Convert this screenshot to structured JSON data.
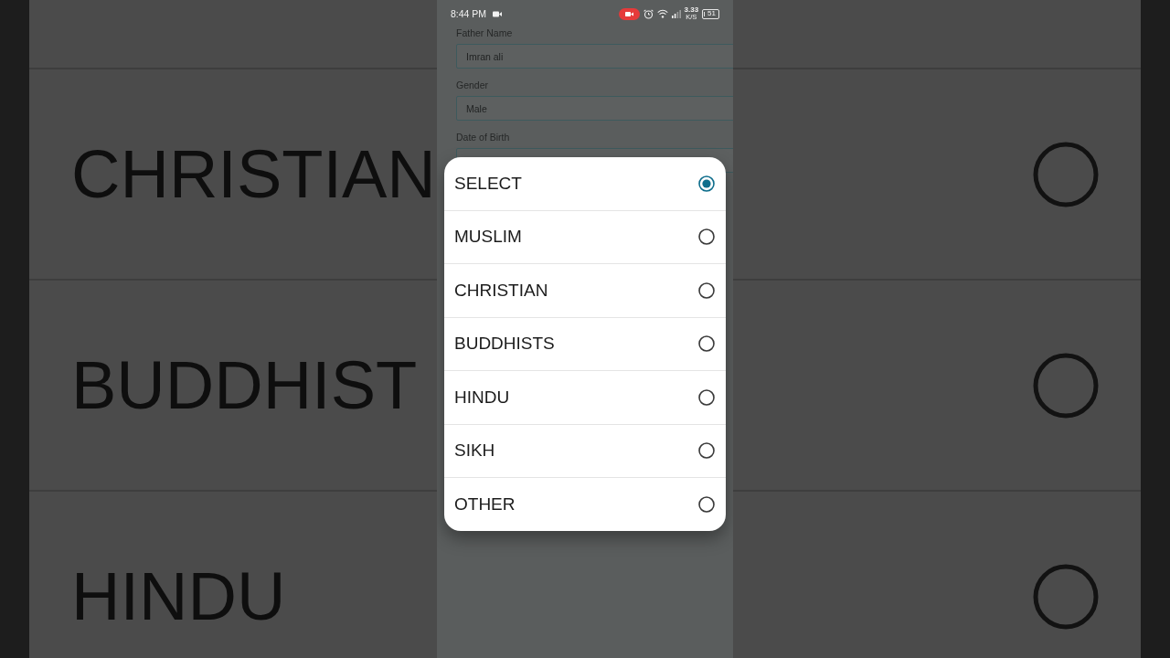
{
  "background": {
    "rows": [
      {
        "label": "CHRISTIAN",
        "selected": false
      },
      {
        "label": "BUDDHIST",
        "selected": false
      },
      {
        "label": "HINDU",
        "selected": false
      }
    ]
  },
  "status_bar": {
    "time": "8:44 PM",
    "network_speed": "3.33",
    "network_unit": "K/S",
    "battery": "51"
  },
  "form": {
    "fields": [
      {
        "label": "Father Name",
        "value": "Imran ali"
      },
      {
        "label": "Gender",
        "value": "Male"
      },
      {
        "label": "Date of Birth"
      }
    ]
  },
  "dialog": {
    "options": [
      {
        "label": "SELECT",
        "selected": true
      },
      {
        "label": "MUSLIM",
        "selected": false
      },
      {
        "label": "CHRISTIAN",
        "selected": false
      },
      {
        "label": "BUDDHISTS",
        "selected": false
      },
      {
        "label": "HINDU",
        "selected": false
      },
      {
        "label": "SIKH",
        "selected": false
      },
      {
        "label": "OTHER",
        "selected": false
      }
    ]
  }
}
